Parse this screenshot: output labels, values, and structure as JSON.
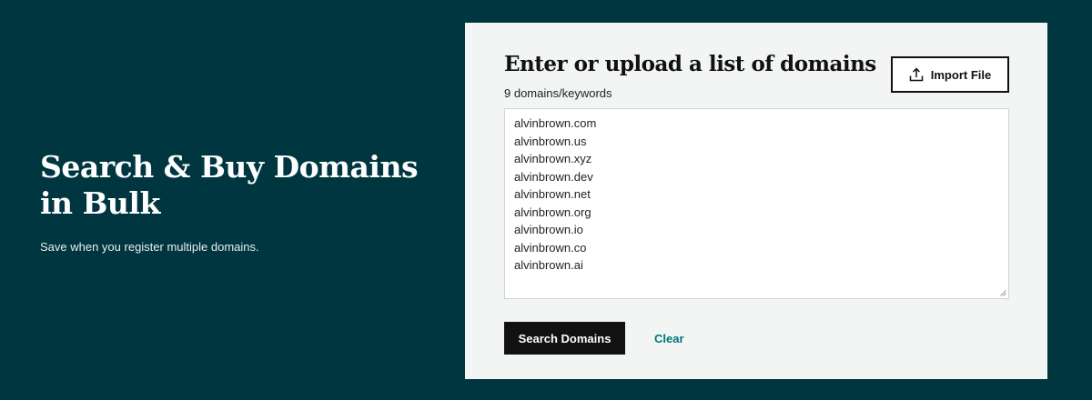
{
  "hero": {
    "title": "Search & Buy Domains in Bulk",
    "subtitle": "Save when you register multiple domains."
  },
  "panel": {
    "title": "Enter or upload a list of domains",
    "count_label": "9 domains/keywords",
    "import_button": {
      "label": "Import File",
      "icon": "upload-icon"
    },
    "domains": [
      "alvinbrown.com",
      "alvinbrown.us",
      "alvinbrown.xyz",
      "alvinbrown.dev",
      "alvinbrown.net",
      "alvinbrown.org",
      "alvinbrown.io",
      "alvinbrown.co",
      "alvinbrown.ai"
    ],
    "search_button": "Search Domains",
    "clear_link": "Clear"
  },
  "colors": {
    "background": "#00363f",
    "panel": "#f3f5f5",
    "primary_button": "#111111",
    "link": "#00747a"
  }
}
